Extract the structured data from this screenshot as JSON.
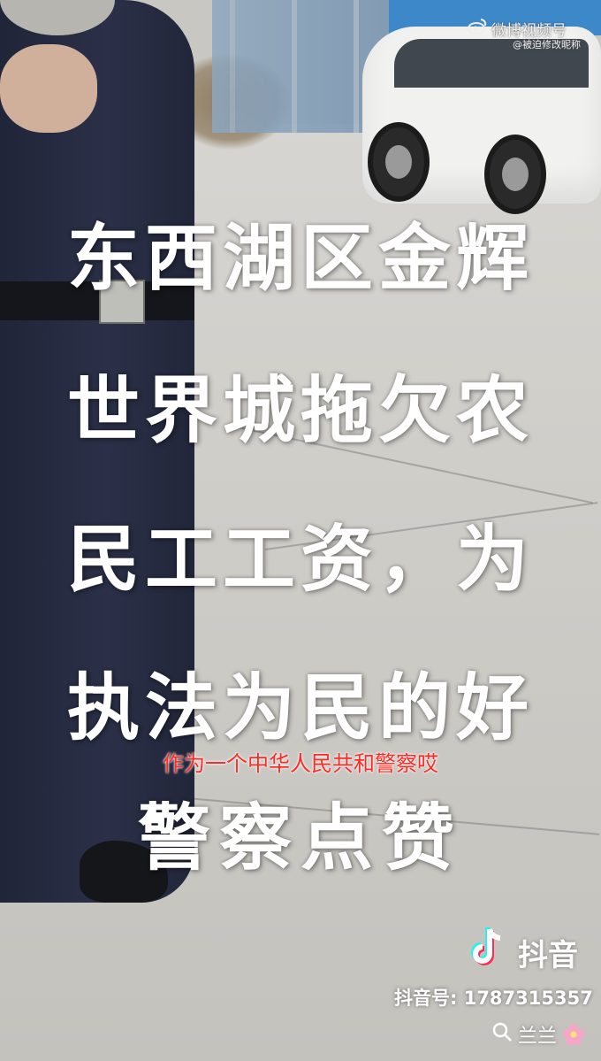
{
  "overlay": {
    "lines": [
      "东西湖区金辉",
      "世界城拖欠农",
      "民工工资，为",
      "执法为民的好",
      "警察点赞"
    ],
    "subtitle": "作为一个中华人民共和警察哎"
  },
  "watermarks": {
    "weibo_label": "微博视频号",
    "weibo_sub": "@被迫修改昵称",
    "douyin_label": "抖音",
    "douyin_id": "抖音号: 1787315357",
    "douyin_user": "兰兰"
  },
  "icons": [
    "weibo-icon",
    "tiktok-icon",
    "search-icon",
    "flower-icon"
  ]
}
